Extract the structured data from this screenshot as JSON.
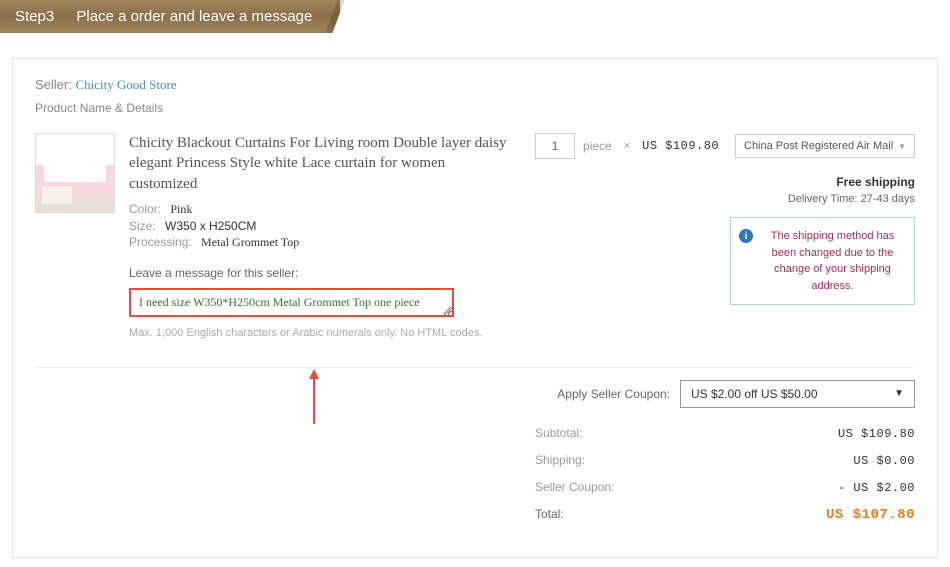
{
  "banner": {
    "step_label": "Step3",
    "step_text": "Place a order and leave a message"
  },
  "seller": {
    "label": "Seller:",
    "name": "Chicity Good Store",
    "product_name_label": "Product Name & Details"
  },
  "product": {
    "title": "Chicity Blackout Curtains For Living room Double layer daisy elegant Princess Style white Lace curtain for women customized",
    "attrs": {
      "color_label": "Color:",
      "color_value": "Pink",
      "size_label": "Size:",
      "size_value": "W350 x H250CM",
      "processing_label": "Processing:",
      "processing_value": "Metal Grommet Top"
    }
  },
  "message": {
    "label": "Leave a message for this seller:",
    "value": "I need size W350*H250cm Metal Grommet Top one piece",
    "hint": "Max. 1,000 English characters or Arabic numerals only. No HTML codes."
  },
  "qty": {
    "value": "1",
    "unit": "piece",
    "x": "×",
    "price": "US $109.80"
  },
  "shipping": {
    "method": "China Post Registered Air Mail",
    "free": "Free shipping",
    "delivery_label": "Delivery Time:",
    "delivery_value": "27-43 days",
    "notice": "The shipping method has been changed due to the change of your shipping address."
  },
  "coupon": {
    "label": "Apply Seller Coupon:",
    "selected": "US $2.00 off US $50.00"
  },
  "summary": {
    "subtotal_label": "Subtotal:",
    "subtotal_value": "US $109.80",
    "shipping_label": "Shipping:",
    "shipping_value": "US $0.00",
    "coupon_label": "Seller Coupon:",
    "coupon_value": "- US $2.00",
    "total_label": "Total:",
    "total_value": "US $107.80"
  }
}
